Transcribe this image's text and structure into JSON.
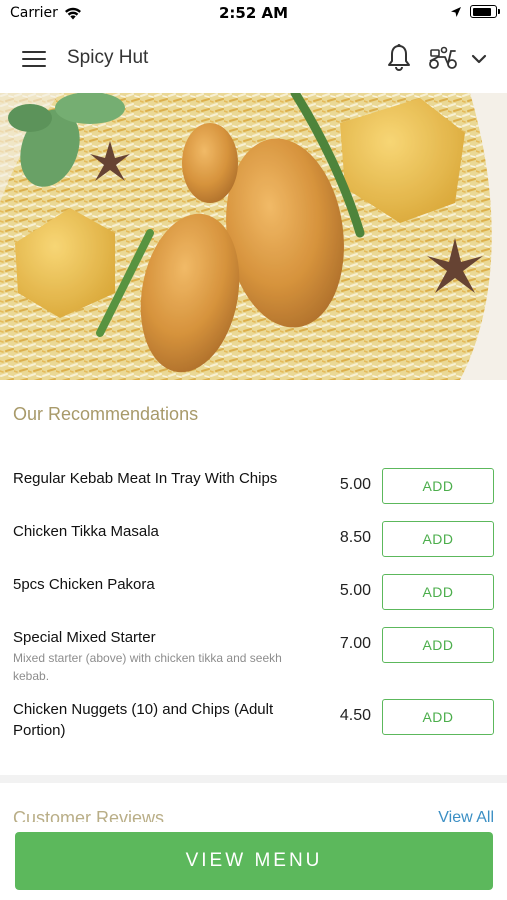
{
  "status_bar": {
    "carrier": "Carrier",
    "time": "2:52 AM",
    "battery_level": 0.9
  },
  "header": {
    "title": "Spicy Hut",
    "icons": [
      "menu-icon",
      "bell-icon",
      "scooter-icon",
      "chevron-down-icon"
    ]
  },
  "hero": {
    "image": "biryani-dish-photo"
  },
  "recommendations": {
    "title": "Our Recommendations",
    "add_label": "ADD",
    "items": [
      {
        "name": "Regular Kebab Meat In Tray With Chips",
        "description": "",
        "price": "5.00"
      },
      {
        "name": "Chicken Tikka Masala",
        "description": "",
        "price": "8.50"
      },
      {
        "name": "5pcs Chicken Pakora",
        "description": "",
        "price": "5.00"
      },
      {
        "name": "Special Mixed Starter",
        "description": "Mixed starter (above) with chicken tikka and seekh kebab.",
        "price": "7.00"
      },
      {
        "name": "Chicken Nuggets (10) and Chips (Adult Portion)",
        "description": "",
        "price": "4.50"
      }
    ]
  },
  "reviews": {
    "title": "Customer Reviews",
    "view_all": "View All"
  },
  "footer": {
    "view_menu": "VIEW MENU"
  },
  "colors": {
    "accent_green": "#5cb85c",
    "section_title": "#a89a6a",
    "link_blue": "#3b8fc4"
  }
}
